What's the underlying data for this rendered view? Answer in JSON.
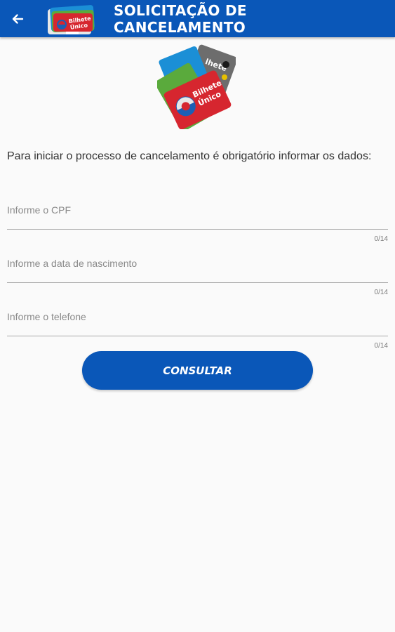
{
  "header": {
    "title_line1": "SOLICITAÇÃO DE",
    "title_line2": "CANCELAMENTO",
    "back_icon": "arrow-left-icon",
    "logo_text": "Bilhete Único"
  },
  "intro": {
    "text": "Para iniciar o processo de cancelamento é obrigatório informar os dados:"
  },
  "form": {
    "cpf": {
      "placeholder": "Informe o CPF",
      "counter": "0/14"
    },
    "nascimento": {
      "placeholder": "Informe a data de nascimento",
      "counter": "0/14"
    },
    "telefone": {
      "placeholder": "Informe o telefone",
      "counter": "0/14"
    }
  },
  "actions": {
    "consultar_label": "CONSULTAR"
  },
  "colors": {
    "primary": "#0a57b8",
    "background": "#fafafa",
    "card_blue": "#1b8fd6",
    "card_green": "#5aaa3c",
    "card_red": "#d6262f",
    "card_gray": "#6d6d6d"
  }
}
